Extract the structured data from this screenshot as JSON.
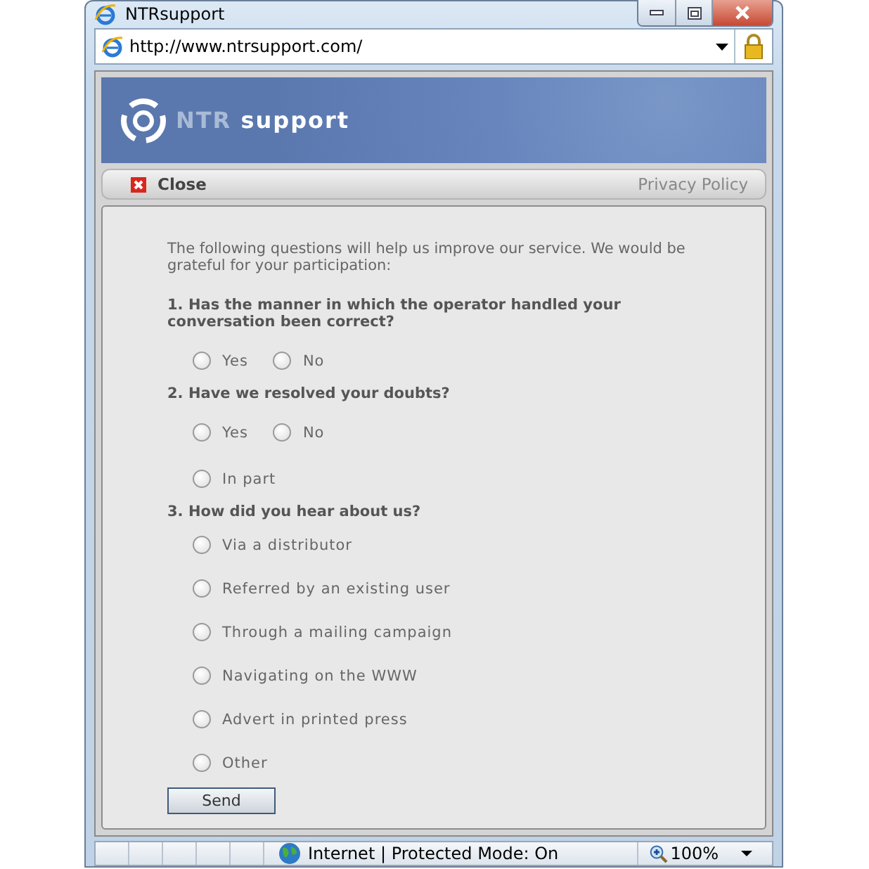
{
  "window": {
    "title": "NTRsupport"
  },
  "address_bar": {
    "url": "http://www.ntrsupport.com/"
  },
  "logo": {
    "prefix": "NTR",
    "suffix": "support"
  },
  "nav": {
    "close": "Close",
    "privacy": "Privacy Policy"
  },
  "intro": "The following questions will help us improve our service. We would be grateful for your participation:",
  "questions": [
    {
      "title": "1. Has the manner in which the operator handled your conversation been correct?",
      "option_rows": [
        [
          {
            "label": "Yes",
            "selected": false
          },
          {
            "label": "No",
            "selected": false
          }
        ]
      ]
    },
    {
      "title": "2. Have we resolved your doubts?",
      "option_rows": [
        [
          {
            "label": "Yes",
            "selected": false
          },
          {
            "label": "No",
            "selected": false
          }
        ],
        [
          {
            "label": "In part",
            "selected": false
          }
        ]
      ]
    },
    {
      "title": "3. How did you hear about us?",
      "option_rows": [
        [
          {
            "label": "Via a distributor",
            "selected": false
          }
        ],
        [
          {
            "label": "Referred by an existing user",
            "selected": false
          }
        ],
        [
          {
            "label": "Through a mailing campaign",
            "selected": false
          }
        ],
        [
          {
            "label": "Navigating on the WWW",
            "selected": false
          }
        ],
        [
          {
            "label": "Advert in printed press",
            "selected": false
          }
        ],
        [
          {
            "label": "Other",
            "selected": false
          }
        ]
      ]
    }
  ],
  "send_button": "Send",
  "status_bar": {
    "zone": "Internet | Protected Mode: On",
    "zoom": "100%"
  }
}
